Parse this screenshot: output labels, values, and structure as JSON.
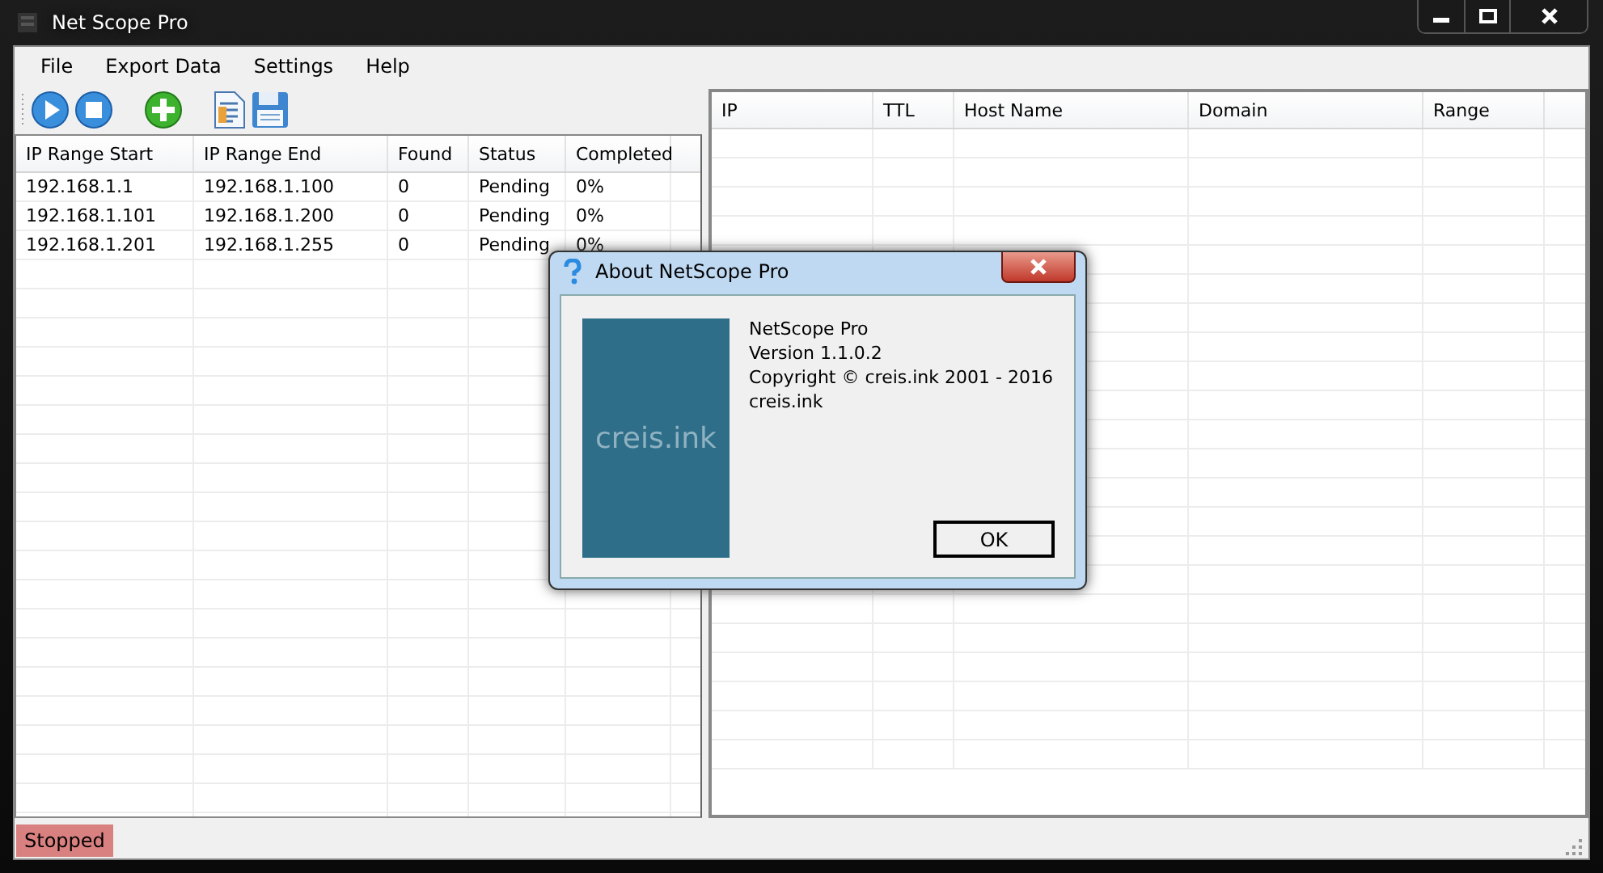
{
  "window": {
    "title": "Net Scope Pro"
  },
  "menu": [
    "File",
    "Export Data",
    "Settings",
    "Help"
  ],
  "ranges_table": {
    "columns": [
      "IP Range Start",
      "IP Range End",
      "Found",
      "Status",
      "Completed"
    ],
    "rows": [
      [
        "192.168.1.1",
        "192.168.1.100",
        "0",
        "Pending",
        "0%"
      ],
      [
        "192.168.1.101",
        "192.168.1.200",
        "0",
        "Pending",
        "0%"
      ],
      [
        "192.168.1.201",
        "192.168.1.255",
        "0",
        "Pending",
        "0%"
      ]
    ]
  },
  "results_table": {
    "columns": [
      "IP",
      "TTL",
      "Host Name",
      "Domain",
      "Range"
    ]
  },
  "status_bar": {
    "text": "Stopped"
  },
  "dialog": {
    "title": "About NetScope Pro",
    "logo_text": "creis.ink",
    "lines": [
      "NetScope Pro",
      "Version 1.1.0.2",
      "Copyright © creis.ink 2001 - 2016",
      "creis.ink"
    ],
    "button": "OK"
  }
}
